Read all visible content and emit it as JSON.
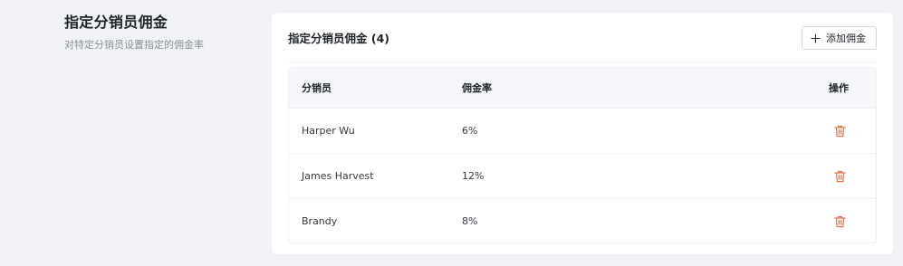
{
  "section": {
    "title": "指定分销员佣金",
    "description": "对特定分销员设置指定的佣金率"
  },
  "card": {
    "title": "指定分销员佣金 (4)",
    "add_button_label": "添加佣金"
  },
  "table": {
    "headers": {
      "distributor": "分销员",
      "rate": "佣金率",
      "action": "操作"
    },
    "rows": [
      {
        "distributor": "Harper Wu",
        "rate": "6%"
      },
      {
        "distributor": "James Harvest",
        "rate": "12%"
      },
      {
        "distributor": "Brandy",
        "rate": "8%"
      }
    ]
  },
  "icons": {
    "add": "plus-icon",
    "delete": "trash-icon"
  },
  "colors": {
    "page_background": "#f1f2f6",
    "card_background": "#ffffff",
    "table_header_background": "#f5f7fa",
    "delete_icon": "#d9744e"
  }
}
